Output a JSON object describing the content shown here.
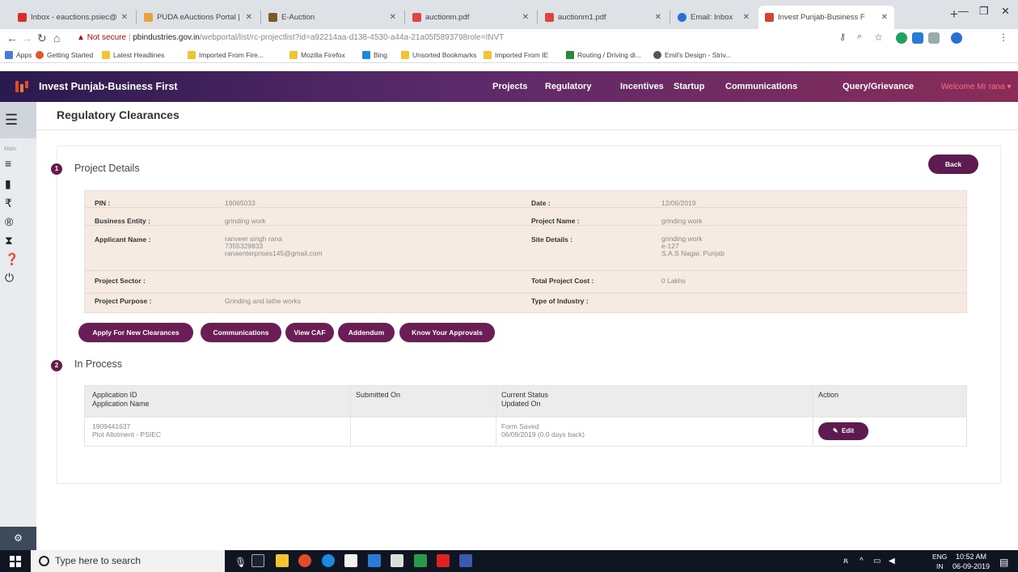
{
  "browser": {
    "tabs": [
      {
        "label": "Inbox - eauctions.psiec@"
      },
      {
        "label": "PUDA eAuctions Portal |"
      },
      {
        "label": "E-Auction"
      },
      {
        "label": "auctionm.pdf"
      },
      {
        "label": "auctionm1.pdf"
      },
      {
        "label": "Email: Inbox"
      },
      {
        "label": "Invest Punjab-Business F"
      }
    ],
    "not_secure": "Not secure",
    "url_host": "pbindustries.gov.in",
    "url_path": "/webportal/list/rc-projectlist?id=a92214aa-d138-4530-a44a-21a05f5893798role=INVT",
    "bookmarks": [
      "Apps",
      "Getting Started",
      "Latest Headlines",
      "Imported From Fire...",
      "Mozilla Firefox",
      "Bing",
      "Unsorted Bookmarks",
      "Imported From IE",
      "Routing / Driving di...",
      "Emil's Design - Striv..."
    ]
  },
  "app": {
    "brand": "Invest Punjab-Business First",
    "menu": [
      "Projects",
      "Regulatory",
      "Incentives",
      "Startup",
      "Communications",
      "Query/Grievance"
    ],
    "welcome": "Welcome Mr rana ▾",
    "sidebar_main": "Main"
  },
  "page": {
    "title": "Regulatory Clearances",
    "back_label": "Back",
    "section1": {
      "num": "1",
      "title": "Project Details"
    },
    "section2": {
      "num": "2",
      "title": "In Process"
    },
    "details": {
      "pin_label": "PIN :",
      "pin": "19065033",
      "date_label": "Date :",
      "date": "12/06/2019",
      "entity_label": "Business Entity :",
      "entity": "grinding work",
      "project_name_label": "Project Name :",
      "project_name": "grinding work",
      "applicant_label": "Applicant Name :",
      "applicant_name": "ranveer singh rana",
      "applicant_phone": "7355329833",
      "applicant_email": "ranaenterprises145@gmail.com",
      "site_label": "Site Details :",
      "site_line1": "grinding work",
      "site_line2": "e-127",
      "site_line3": "S.A.S Nagar, Punjab",
      "sector_label": "Project Sector :",
      "sector": "",
      "cost_label": "Total Project Cost :",
      "cost": "0 Lakhs",
      "purpose_label": "Project Purpose :",
      "purpose": "Grinding and lathe works",
      "industry_label": "Type of Industry :",
      "industry": ""
    },
    "actions": [
      "Apply For New Clearances",
      "Communications",
      "View CAF",
      "Addendum",
      "Know Your Approvals"
    ],
    "table": {
      "headers": {
        "col1a": "Application ID",
        "col1b": "Application Name",
        "col2": "Submitted On",
        "col3a": "Current Status",
        "col3b": "Updated On",
        "col4": "Action"
      },
      "row": {
        "app_id": "1909441637",
        "app_name": "Plot Allotment - PSIEC",
        "submitted": "",
        "status": "Form Saved",
        "updated": "06/09/2019 (0.0 days back)",
        "action": "Edit"
      }
    }
  },
  "taskbar": {
    "search_placeholder": "Type here to search",
    "lang1": "ENG",
    "lang2": "IN",
    "time": "10:52 AM",
    "date": "06-09-2019"
  }
}
